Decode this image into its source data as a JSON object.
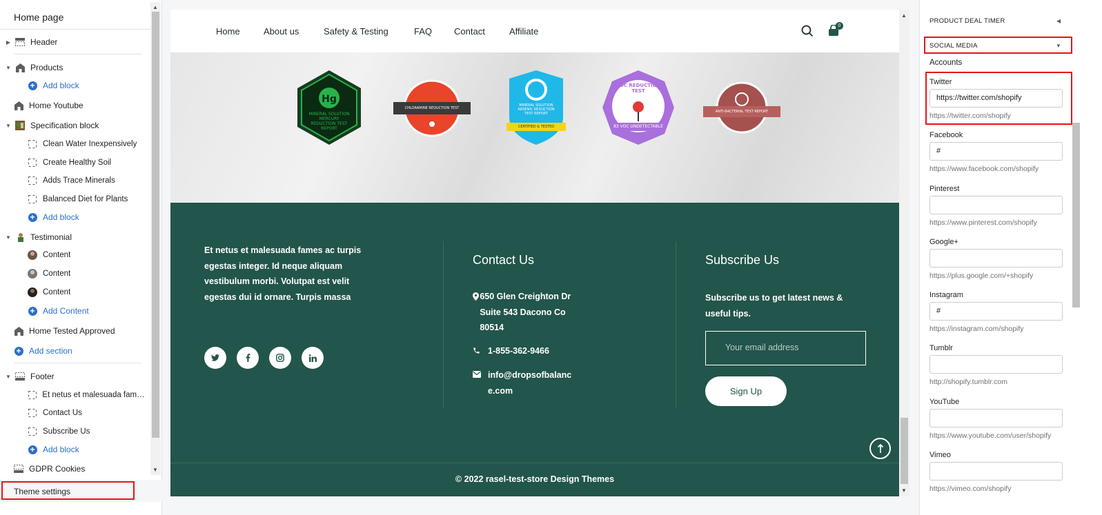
{
  "sidebar": {
    "title": "Home page",
    "items": {
      "header": "Header",
      "products": "Products",
      "products_add": "Add block",
      "home_youtube": "Home Youtube",
      "spec": "Specification block",
      "spec_1": "Clean Water Inexpensively",
      "spec_2": "Create Healthy Soil",
      "spec_3": "Adds Trace Minerals",
      "spec_4": "Balanced Diet for Plants",
      "spec_add": "Add block",
      "testimonial": "Testimonial",
      "test_1": "Content",
      "test_2": "Content",
      "test_3": "Content",
      "test_add": "Add Content",
      "tested": "Home Tested Approved",
      "add_section": "Add section",
      "footer": "Footer",
      "footer_1": "Et netus et malesuada fames ...",
      "footer_2": "Contact Us",
      "footer_3": "Subscribe Us",
      "footer_add": "Add block",
      "gdpr": "GDPR Cookies"
    },
    "theme_settings": "Theme settings"
  },
  "preview": {
    "nav": [
      "Home",
      "About us",
      "Safety & Testing",
      "FAQ",
      "Contact",
      "Affiliate"
    ],
    "cart_count": "0",
    "badges": {
      "b1_top": "Hg",
      "b1_text": "MINERAL SOLUTION MERCURY REDUCTION TEST REPORT",
      "b2_text": "CHLORAMINE REDUCTION TEST REPORT",
      "b3_text": "MINERAL SOLUTION ARSENIC REDUCTION TEST REPORT",
      "b3_ribbon": "CERTIFIED & TESTED",
      "b4_text": "VOC REDUCTION TEST",
      "b4_ribbon": "83 VOC UNDETECTABLE",
      "b5_text": "ANTI-BACTERIAL TEST REPORT"
    },
    "footer": {
      "about": "Et netus et malesuada fames ac turpis egestas integer. Id neque aliquam vestibulum morbi. Volutpat est velit egestas dui id ornare. Turpis massa",
      "contact_heading": "Contact Us",
      "address": "650 Glen Creighton Dr Suite 543 Dacono Co 80514",
      "phone": "1-855-362-9466",
      "email": "info@dropsofbalance.com",
      "subscribe_heading": "Subscribe Us",
      "subscribe_text": "Subscribe us to get latest news & useful tips.",
      "email_placeholder": "Your email address",
      "signup": "Sign Up",
      "copyright": "© 2022 rasel-test-store Design Themes"
    }
  },
  "right_panel": {
    "section_timer": "PRODUCT DEAL TIMER",
    "section_social": "SOCIAL MEDIA",
    "accounts": "Accounts",
    "fields": [
      {
        "label": "Twitter",
        "value": "https://twitter.com/shopify",
        "help": "https://twitter.com/shopify"
      },
      {
        "label": "Facebook",
        "value": "#",
        "help": "https://www.facebook.com/shopify"
      },
      {
        "label": "Pinterest",
        "value": "",
        "help": "https://www.pinterest.com/shopify"
      },
      {
        "label": "Google+",
        "value": "",
        "help": "https://plus.google.com/+shopify"
      },
      {
        "label": "Instagram",
        "value": "#",
        "help": "https://instagram.com/shopify"
      },
      {
        "label": "Tumblr",
        "value": "",
        "help": "http://shopify.tumblr.com"
      },
      {
        "label": "YouTube",
        "value": "",
        "help": "https://www.youtube.com/user/shopify"
      },
      {
        "label": "Vimeo",
        "value": "",
        "help": "https://vimeo.com/shopify"
      }
    ]
  },
  "colors": {
    "footer_bg": "#22554b",
    "accent_blue": "#2c6ecb",
    "highlight_red": "#e3151a"
  }
}
